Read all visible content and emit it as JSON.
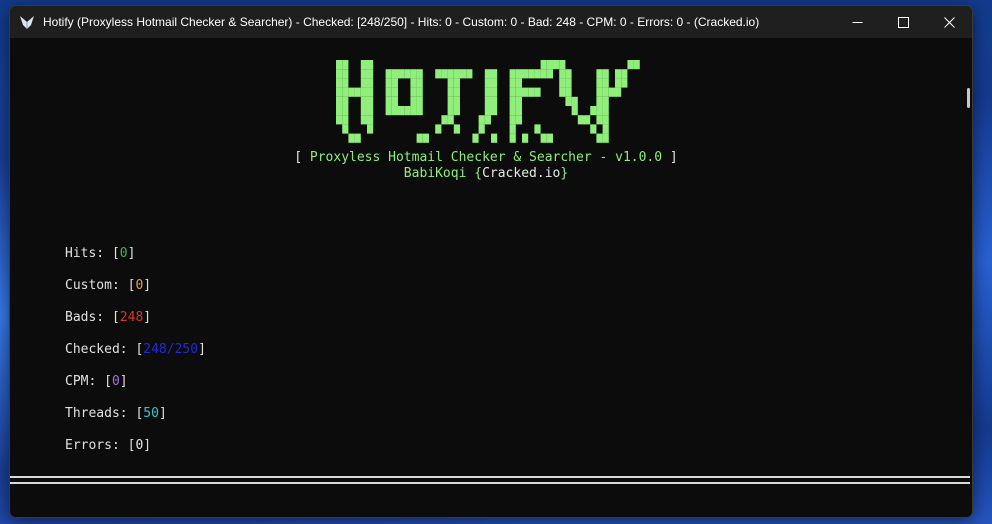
{
  "window": {
    "title": "Hotify (Proxyless Hotmail Checker & Searcher) - Checked: [248/250] - Hits: 0 - Custom: 0 - Bad: 248 - CPM: 0 - Errors: 0 - (Cracked.io)"
  },
  "banner": {
    "logo_text": "HOTIFY",
    "logo_color": "#8fef7a",
    "subtitle_open": "[ ",
    "subtitle": "Proxyless Hotmail Checker & Searcher - v1.0.0",
    "subtitle_close": " ]",
    "author": "BabiKoqi",
    "site_open": " {",
    "site": "Cracked.io",
    "site_close": "}"
  },
  "stats": [
    {
      "label": "Hits: [",
      "value": "0",
      "close": "]",
      "color": "#3fb950"
    },
    {
      "label": "Custom: [",
      "value": "0",
      "close": "]",
      "color": "#e8a33d"
    },
    {
      "label": "Bads: [",
      "value": "248",
      "close": "]",
      "color": "#e0302c"
    },
    {
      "label": "Checked: [",
      "value": "248/250",
      "close": "]",
      "color": "#1f2bd6"
    },
    {
      "label": "CPM: [",
      "value": "0",
      "close": "]",
      "color": "#a86fe0"
    },
    {
      "label": "Threads: [",
      "value": "50",
      "close": "]",
      "color": "#39c5cf"
    },
    {
      "label": "Errors: [",
      "value": "0",
      "close": "]",
      "color": "#e8e8e8"
    }
  ],
  "divider": "========================================================================================================================================"
}
